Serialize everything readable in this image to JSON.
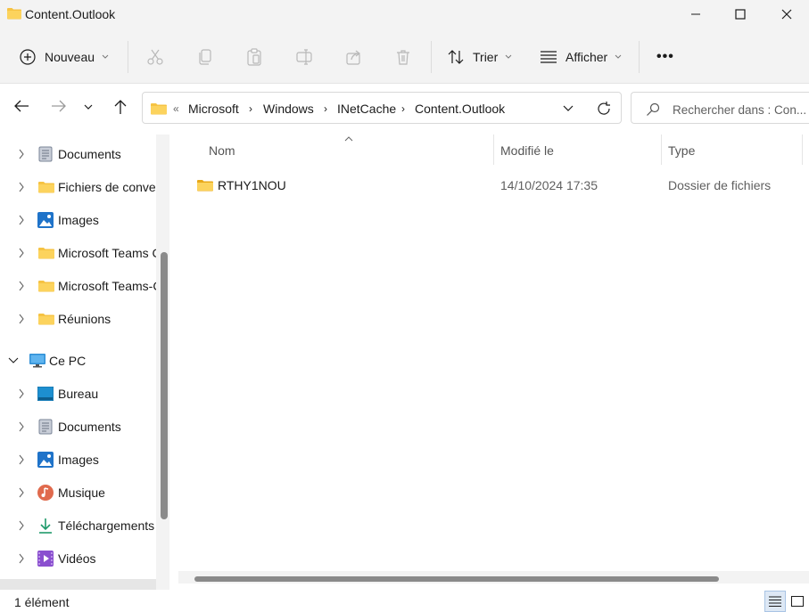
{
  "window": {
    "title": "Content.Outlook"
  },
  "toolbar": {
    "new_label": "Nouveau",
    "sort_label": "Trier",
    "view_label": "Afficher",
    "more_label": "•••"
  },
  "address": {
    "overflow": "«",
    "crumbs": [
      "Microsoft",
      "Windows",
      "INetCache",
      "Content.Outlook"
    ],
    "search_placeholder": "Rechercher dans : Con..."
  },
  "sidebar": {
    "items": [
      {
        "label": "Documents",
        "icon": "documents-icon"
      },
      {
        "label": "Fichiers de conver",
        "icon": "folder-icon"
      },
      {
        "label": "Images",
        "icon": "images-icon"
      },
      {
        "label": "Microsoft Teams C",
        "icon": "folder-icon"
      },
      {
        "label": "Microsoft Teams-C",
        "icon": "folder-icon"
      },
      {
        "label": "Réunions",
        "icon": "folder-icon"
      },
      {
        "label": "Ce PC",
        "icon": "pc-icon"
      },
      {
        "label": "Bureau",
        "icon": "desktop-icon"
      },
      {
        "label": "Documents",
        "icon": "documents-icon"
      },
      {
        "label": "Images",
        "icon": "images-icon"
      },
      {
        "label": "Musique",
        "icon": "music-icon"
      },
      {
        "label": "Téléchargements",
        "icon": "download-icon"
      },
      {
        "label": "Vidéos",
        "icon": "videos-icon"
      }
    ]
  },
  "content": {
    "columns": {
      "name": "Nom",
      "modified": "Modifié le",
      "type": "Type"
    },
    "rows": [
      {
        "name": "RTHY1NOU",
        "modified": "14/10/2024 17:35",
        "type": "Dossier de fichiers"
      }
    ]
  },
  "status": {
    "count": "1 élément"
  },
  "colors": {
    "folder": "#f6c343",
    "folder_dark": "#e8a91a",
    "chrome": "#f3f3f3"
  }
}
